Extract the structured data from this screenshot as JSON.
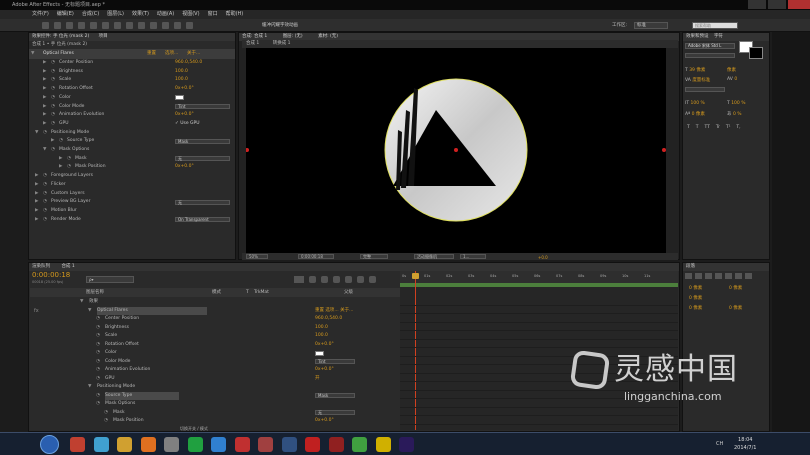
{
  "app": {
    "title": "Adobe After Effects - 无标题项目.aep *",
    "menu": [
      "文件(F)",
      "编辑(E)",
      "合成(C)",
      "图层(L)",
      "效果(T)",
      "动画(A)",
      "视图(V)",
      "窗口",
      "帮助(H)"
    ],
    "toolbar_hint": "缓冲闪耀字效动画",
    "workspace_label": "工作区:",
    "workspace_value": "标准",
    "search_placeholder": "搜索帮助"
  },
  "effect_controls": {
    "tabs": [
      "效果控件: 手 位光 (mask 2)",
      "项目"
    ],
    "path": "合成 1 • 手 位光 (mask 2)",
    "effect_name": "Optical Flares",
    "links": [
      "重置",
      "选项...",
      "关于..."
    ],
    "rows": [
      {
        "label": "Center Position",
        "value": "960.0,540.0",
        "indent": 1
      },
      {
        "label": "Brightness",
        "value": "100.0",
        "indent": 1
      },
      {
        "label": "Scale",
        "value": "100.0",
        "indent": 1
      },
      {
        "label": "Rotation Offset",
        "value": "0x+0.0°",
        "indent": 1
      },
      {
        "label": "Color",
        "swatch": "#ffffff",
        "indent": 1
      },
      {
        "label": "Color Mode",
        "dropdown": "Tint",
        "indent": 1
      },
      {
        "label": "Animation Evolution",
        "value": "0x+0.0°",
        "indent": 1
      },
      {
        "label": "GPU",
        "check": "Use GPU",
        "indent": 1
      },
      {
        "label": "Positioning Mode",
        "indent": 0,
        "open": true
      },
      {
        "label": "Source Type",
        "dropdown": "Mask",
        "indent": 2
      },
      {
        "label": "Mask Options",
        "indent": 1,
        "open": true
      },
      {
        "label": "Mask",
        "dropdown": "无",
        "indent": 3
      },
      {
        "label": "Mask Position",
        "value": "0x+0.0°",
        "indent": 3
      },
      {
        "label": "Foreground Layers",
        "indent": 0
      },
      {
        "label": "Flicker",
        "indent": 0
      },
      {
        "label": "Custom Layers",
        "indent": 0
      },
      {
        "label": "Preview BG Layer",
        "dropdown": "无",
        "indent": 0
      },
      {
        "label": "Motion Blur",
        "indent": 0
      },
      {
        "label": "Render Mode",
        "dropdown": "On Transparent",
        "indent": 0
      }
    ]
  },
  "composition": {
    "tabs": [
      "合成: 合成 1",
      "图层: (无)",
      "素材: (无)"
    ],
    "subtabs": [
      "合成 1",
      "转换成 1"
    ],
    "zoom": "50%",
    "timecode": "0:00:00:18",
    "resolution": "完整",
    "camera": "活动摄像机",
    "views": "1...",
    "exposure": "+0.0"
  },
  "right_panel": {
    "tabs": [
      "效果和预设",
      "字符"
    ],
    "font_name": "Adobe 宋体 Std L",
    "font_size": "39 像素",
    "leading": "像素",
    "kerning": "度量标准",
    "tracking": "0",
    "v_scale": "100 %",
    "h_scale": "100 %",
    "baseline": "0 像素",
    "tsume": "0 %",
    "styles": [
      "T",
      "T",
      "TT",
      "Tr",
      "T¹",
      "T,"
    ]
  },
  "timeline": {
    "tabs": [
      "渲染队列",
      "合成 1"
    ],
    "timecode": "0:00:00:18",
    "frame": "00018 (25.00 fps)",
    "search_placeholder": "ρ▾",
    "columns": [
      "图层名称",
      "模式",
      "T",
      "TrkMat",
      "父级"
    ],
    "ruler": [
      "0s",
      "01s",
      "02s",
      "03s",
      "04s",
      "05s",
      "06s",
      "07s",
      "08s",
      "09s",
      "10s",
      "11s"
    ],
    "rows": [
      {
        "label": "效果",
        "indent": 0
      },
      {
        "label": "Optical Flares",
        "indent": 1,
        "selected": true,
        "links": "重置  选项...  关于..."
      },
      {
        "label": "Center Position",
        "value": "960.0,540.0",
        "indent": 2
      },
      {
        "label": "Brightness",
        "value": "100.0",
        "indent": 2
      },
      {
        "label": "Scale",
        "value": "100.0",
        "indent": 2
      },
      {
        "label": "Rotation Offset",
        "value": "0x+0.0°",
        "indent": 2
      },
      {
        "label": "Color",
        "swatch": "#ffffff",
        "indent": 2
      },
      {
        "label": "Color Mode",
        "dropdown": "Tint",
        "indent": 2
      },
      {
        "label": "Animation Evolution",
        "value": "0x+0.0°",
        "indent": 2
      },
      {
        "label": "GPU",
        "value": "开",
        "indent": 2
      },
      {
        "label": "Positioning Mode",
        "indent": 1
      },
      {
        "label": "Source Type",
        "dropdown": "Mask",
        "indent": 2,
        "hl": true
      },
      {
        "label": "Mask Options",
        "indent": 2
      },
      {
        "label": "Mask",
        "dropdown": "无",
        "indent": 3
      },
      {
        "label": "Mask Position",
        "value": "0x+0.0°",
        "indent": 3
      }
    ],
    "footer": "切换开关 / 模式"
  },
  "paragraph": {
    "tab": "段落",
    "fields": [
      "0 像素",
      "0 像素",
      "0 像素",
      "0 像素",
      "0 像素"
    ]
  },
  "watermark": {
    "brand": "灵感中国",
    "url": "lingganchina.com"
  },
  "taskbar": {
    "lang": "CH",
    "time": "18:04",
    "date": "2014/7/1",
    "icons": [
      {
        "name": "start",
        "color": "#2a5fb0"
      },
      {
        "name": "app",
        "color": "#c04030"
      },
      {
        "name": "app",
        "color": "#40a0d0"
      },
      {
        "name": "app",
        "color": "#d0a030"
      },
      {
        "name": "app",
        "color": "#e07020"
      },
      {
        "name": "app",
        "color": "#808080"
      },
      {
        "name": "app",
        "color": "#20a040"
      },
      {
        "name": "app",
        "color": "#3080d0"
      },
      {
        "name": "app",
        "color": "#c03030"
      },
      {
        "name": "app",
        "color": "#a04040"
      },
      {
        "name": "app",
        "color": "#305080"
      },
      {
        "name": "app",
        "color": "#c02020"
      },
      {
        "name": "app",
        "color": "#902020"
      },
      {
        "name": "app",
        "color": "#40a040"
      },
      {
        "name": "app",
        "color": "#d0b000"
      },
      {
        "name": "ae",
        "color": "#2a1a5a"
      }
    ]
  }
}
